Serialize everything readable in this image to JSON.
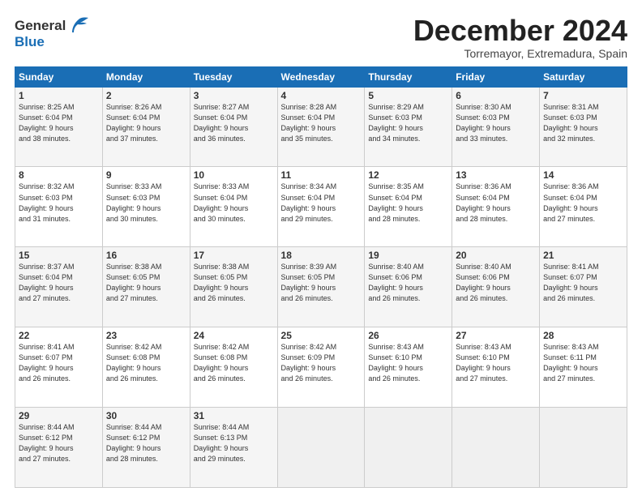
{
  "header": {
    "logo_line1": "General",
    "logo_line2": "Blue",
    "month": "December 2024",
    "location": "Torremayor, Extremadura, Spain"
  },
  "weekdays": [
    "Sunday",
    "Monday",
    "Tuesday",
    "Wednesday",
    "Thursday",
    "Friday",
    "Saturday"
  ],
  "weeks": [
    [
      {
        "day": "1",
        "detail": "Sunrise: 8:25 AM\nSunset: 6:04 PM\nDaylight: 9 hours\nand 38 minutes."
      },
      {
        "day": "2",
        "detail": "Sunrise: 8:26 AM\nSunset: 6:04 PM\nDaylight: 9 hours\nand 37 minutes."
      },
      {
        "day": "3",
        "detail": "Sunrise: 8:27 AM\nSunset: 6:04 PM\nDaylight: 9 hours\nand 36 minutes."
      },
      {
        "day": "4",
        "detail": "Sunrise: 8:28 AM\nSunset: 6:04 PM\nDaylight: 9 hours\nand 35 minutes."
      },
      {
        "day": "5",
        "detail": "Sunrise: 8:29 AM\nSunset: 6:03 PM\nDaylight: 9 hours\nand 34 minutes."
      },
      {
        "day": "6",
        "detail": "Sunrise: 8:30 AM\nSunset: 6:03 PM\nDaylight: 9 hours\nand 33 minutes."
      },
      {
        "day": "7",
        "detail": "Sunrise: 8:31 AM\nSunset: 6:03 PM\nDaylight: 9 hours\nand 32 minutes."
      }
    ],
    [
      {
        "day": "8",
        "detail": "Sunrise: 8:32 AM\nSunset: 6:03 PM\nDaylight: 9 hours\nand 31 minutes."
      },
      {
        "day": "9",
        "detail": "Sunrise: 8:33 AM\nSunset: 6:03 PM\nDaylight: 9 hours\nand 30 minutes."
      },
      {
        "day": "10",
        "detail": "Sunrise: 8:33 AM\nSunset: 6:04 PM\nDaylight: 9 hours\nand 30 minutes."
      },
      {
        "day": "11",
        "detail": "Sunrise: 8:34 AM\nSunset: 6:04 PM\nDaylight: 9 hours\nand 29 minutes."
      },
      {
        "day": "12",
        "detail": "Sunrise: 8:35 AM\nSunset: 6:04 PM\nDaylight: 9 hours\nand 28 minutes."
      },
      {
        "day": "13",
        "detail": "Sunrise: 8:36 AM\nSunset: 6:04 PM\nDaylight: 9 hours\nand 28 minutes."
      },
      {
        "day": "14",
        "detail": "Sunrise: 8:36 AM\nSunset: 6:04 PM\nDaylight: 9 hours\nand 27 minutes."
      }
    ],
    [
      {
        "day": "15",
        "detail": "Sunrise: 8:37 AM\nSunset: 6:04 PM\nDaylight: 9 hours\nand 27 minutes."
      },
      {
        "day": "16",
        "detail": "Sunrise: 8:38 AM\nSunset: 6:05 PM\nDaylight: 9 hours\nand 27 minutes."
      },
      {
        "day": "17",
        "detail": "Sunrise: 8:38 AM\nSunset: 6:05 PM\nDaylight: 9 hours\nand 26 minutes."
      },
      {
        "day": "18",
        "detail": "Sunrise: 8:39 AM\nSunset: 6:05 PM\nDaylight: 9 hours\nand 26 minutes."
      },
      {
        "day": "19",
        "detail": "Sunrise: 8:40 AM\nSunset: 6:06 PM\nDaylight: 9 hours\nand 26 minutes."
      },
      {
        "day": "20",
        "detail": "Sunrise: 8:40 AM\nSunset: 6:06 PM\nDaylight: 9 hours\nand 26 minutes."
      },
      {
        "day": "21",
        "detail": "Sunrise: 8:41 AM\nSunset: 6:07 PM\nDaylight: 9 hours\nand 26 minutes."
      }
    ],
    [
      {
        "day": "22",
        "detail": "Sunrise: 8:41 AM\nSunset: 6:07 PM\nDaylight: 9 hours\nand 26 minutes."
      },
      {
        "day": "23",
        "detail": "Sunrise: 8:42 AM\nSunset: 6:08 PM\nDaylight: 9 hours\nand 26 minutes."
      },
      {
        "day": "24",
        "detail": "Sunrise: 8:42 AM\nSunset: 6:08 PM\nDaylight: 9 hours\nand 26 minutes."
      },
      {
        "day": "25",
        "detail": "Sunrise: 8:42 AM\nSunset: 6:09 PM\nDaylight: 9 hours\nand 26 minutes."
      },
      {
        "day": "26",
        "detail": "Sunrise: 8:43 AM\nSunset: 6:10 PM\nDaylight: 9 hours\nand 26 minutes."
      },
      {
        "day": "27",
        "detail": "Sunrise: 8:43 AM\nSunset: 6:10 PM\nDaylight: 9 hours\nand 27 minutes."
      },
      {
        "day": "28",
        "detail": "Sunrise: 8:43 AM\nSunset: 6:11 PM\nDaylight: 9 hours\nand 27 minutes."
      }
    ],
    [
      {
        "day": "29",
        "detail": "Sunrise: 8:44 AM\nSunset: 6:12 PM\nDaylight: 9 hours\nand 27 minutes."
      },
      {
        "day": "30",
        "detail": "Sunrise: 8:44 AM\nSunset: 6:12 PM\nDaylight: 9 hours\nand 28 minutes."
      },
      {
        "day": "31",
        "detail": "Sunrise: 8:44 AM\nSunset: 6:13 PM\nDaylight: 9 hours\nand 29 minutes."
      },
      {
        "day": "",
        "detail": ""
      },
      {
        "day": "",
        "detail": ""
      },
      {
        "day": "",
        "detail": ""
      },
      {
        "day": "",
        "detail": ""
      }
    ]
  ]
}
